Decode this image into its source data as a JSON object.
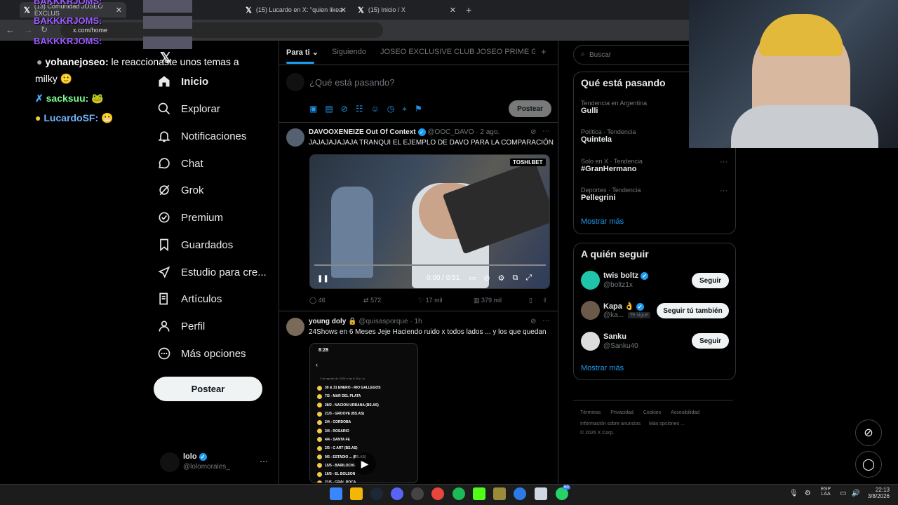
{
  "browser": {
    "tabs": [
      {
        "label": "(13) Comunidad JOSEO EXCLUS"
      },
      {
        "label": "(15) Lucardo en X: \"quien likea"
      },
      {
        "label": "(15) Inicio / X"
      }
    ],
    "new_tab": "+",
    "url": "x.com/home"
  },
  "overlay_chat": {
    "badge_text": "BAKKKRJOMS:",
    "lines": [
      {
        "user": "yohanejoseo:",
        "text": "le reaccionaste unos temas a"
      },
      {
        "user": "",
        "text": "milky"
      },
      {
        "user": "sacksuu:",
        "text": ""
      },
      {
        "user": "LucardoSF:",
        "text": ""
      }
    ]
  },
  "nav": {
    "items": [
      {
        "label": "Inicio",
        "icon": "home-icon"
      },
      {
        "label": "Explorar",
        "icon": "search-icon"
      },
      {
        "label": "Notificaciones",
        "icon": "bell-icon"
      },
      {
        "label": "Chat",
        "icon": "chat-icon"
      },
      {
        "label": "Grok",
        "icon": "grok-icon"
      },
      {
        "label": "Premium",
        "icon": "premium-icon"
      },
      {
        "label": "Guardados",
        "icon": "bookmark-icon"
      },
      {
        "label": "Estudio para cre...",
        "icon": "rocket-icon"
      },
      {
        "label": "Artículos",
        "icon": "article-icon"
      },
      {
        "label": "Perfil",
        "icon": "person-icon"
      },
      {
        "label": "Más opciones",
        "icon": "more-icon"
      }
    ],
    "post_button": "Postear",
    "account": {
      "name": "lolo",
      "handle": "@lolomorales_",
      "more": "···"
    }
  },
  "feed": {
    "tabs": [
      "Para ti",
      "Siguiendo",
      "JOSEO EXCLUSIVE CLUB",
      "JOSEO PRIME GR"
    ],
    "add_tab": "+",
    "composer": {
      "placeholder": "¿Qué está pasando?",
      "button": "Postear"
    },
    "tweets": [
      {
        "name": "DAVOOXENEIZE Out Of Context",
        "handle": "@OOC_DAVO",
        "time": "· 2 ago.",
        "text": "JAJAJAJAJAJA TRANQUI EL EJEMPLO DE DAVO PARA LA COMPARACIÓN",
        "video": {
          "watermark": "TOSHI.BET",
          "time": "0:00 / 0:51"
        },
        "stats": {
          "replies": "46",
          "reposts": "572",
          "likes": "17 mil",
          "views": "379 mil"
        }
      },
      {
        "name": "young doly",
        "handle": "@quisasporque",
        "time": "· 1h",
        "text": "24Shows en 6 Meses Jeje Haciendo ruido x todos lados ... y los que quedan",
        "phone": {
          "clock": "8:28",
          "date": "3 de agosto de 2026 a las 8:28 p. m.",
          "items": [
            "30 & 31 ENERO - RIO GALLEGOS",
            "7/2 - MAR DEL PLATA",
            "28/2 - NACION URBANA (BS.AS)",
            "21/3 - GROOVE (BS.AS)",
            "2/4 - CORDOBA",
            "3/4 - ROSARIO",
            "4/4 - SANTA FE",
            "2/5 - C ART (BS.AS)",
            "9/5 - ESTADIO ... (BS.AS)",
            "15/5 - BARILOCHE",
            "16/5 - EL BOLSON",
            "21/5 - GRAL ROCA"
          ]
        }
      }
    ]
  },
  "sidebar": {
    "search_placeholder": "Buscar",
    "trends_title": "Qué está pasando",
    "trends": [
      {
        "category": "Tendencia en Argentina",
        "name": "Gulli"
      },
      {
        "category": "Política · Tendencia",
        "name": "Quintela"
      },
      {
        "category": "Solo en X · Tendencia",
        "name": "#GranHermano"
      },
      {
        "category": "Deportes · Tendencia",
        "name": "Pellegrini"
      }
    ],
    "show_more": "Mostrar más",
    "follow_title": "A quién seguir",
    "follow": [
      {
        "name": "twis boltz",
        "handle": "@boltz1x",
        "button": "Seguir",
        "tag": ""
      },
      {
        "name": "Kapa",
        "handle": "@ka...",
        "button": "Seguir tú también",
        "tag": "Te sigue"
      },
      {
        "name": "Sanku",
        "handle": "@Sanku40",
        "button": "Seguir",
        "tag": ""
      }
    ],
    "follow_more": "Mostrar más",
    "footer": [
      "Términos",
      "Privacidad",
      "Cookies",
      "Accesibilidad",
      "Información sobre anuncios",
      "Más opciones ...",
      "© 2026 X Corp."
    ]
  },
  "taskbar": {
    "lang1": "ESP",
    "lang2": "LAA",
    "time": "22:13",
    "date": "3/8/2026",
    "badge": "50"
  },
  "colors": {
    "accent": "#1d9bf0",
    "bg": "#000000",
    "border": "#2f3336",
    "muted": "#71767b"
  }
}
